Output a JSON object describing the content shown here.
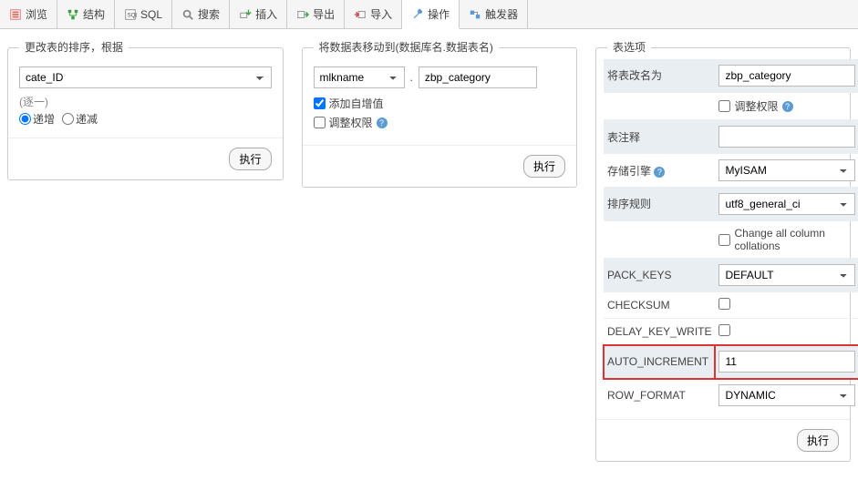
{
  "tabs": {
    "browse": "浏览",
    "structure": "结构",
    "sql": "SQL",
    "search": "搜索",
    "insert": "插入",
    "export": "导出",
    "import": "导入",
    "operations": "操作",
    "triggers": "触发器"
  },
  "sort_panel": {
    "title": "更改表的排序，根据",
    "column_selected": "cate_ID",
    "either_note": "(逐一)",
    "asc_label": "递增",
    "desc_label": "递减",
    "submit": "执行"
  },
  "move_panel": {
    "title": "将数据表移动到(数据库名.数据表名)",
    "db_selected": "mlkname",
    "table_name": "zbp_category",
    "add_autoinc_label": "添加自增值",
    "adjust_priv_label": "调整权限",
    "submit": "执行"
  },
  "options_panel": {
    "title": "表选项",
    "rename_label": "将表改名为",
    "rename_value": "zbp_category",
    "adjust_priv_label": "调整权限",
    "comment_label": "表注释",
    "comment_value": "",
    "engine_label": "存储引擎",
    "engine_value": "MyISAM",
    "collation_label": "排序规则",
    "collation_value": "utf8_general_ci",
    "change_collations_label": "Change all column collations",
    "pack_keys_label": "PACK_KEYS",
    "pack_keys_value": "DEFAULT",
    "checksum_label": "CHECKSUM",
    "delay_key_write_label": "DELAY_KEY_WRITE",
    "auto_increment_label": "AUTO_INCREMENT",
    "auto_increment_value": "11",
    "row_format_label": "ROW_FORMAT",
    "row_format_value": "DYNAMIC",
    "submit": "执行"
  }
}
